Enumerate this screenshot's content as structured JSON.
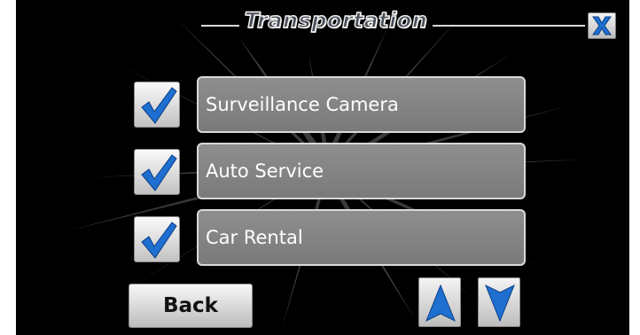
{
  "header": {
    "title": "Transportation",
    "close_icon": "close-x-icon"
  },
  "categories": [
    {
      "label": "Surveillance Camera",
      "checked": true
    },
    {
      "label": "Auto Service",
      "checked": true
    },
    {
      "label": "Car Rental",
      "checked": true
    }
  ],
  "footer": {
    "back_label": "Back",
    "up_icon": "arrow-up-icon",
    "down_icon": "arrow-down-icon"
  },
  "colors": {
    "background": "#000000",
    "item_button": "#858585",
    "accent_blue": "#1e6fd0",
    "icon_gray": "#d8d8d8"
  }
}
